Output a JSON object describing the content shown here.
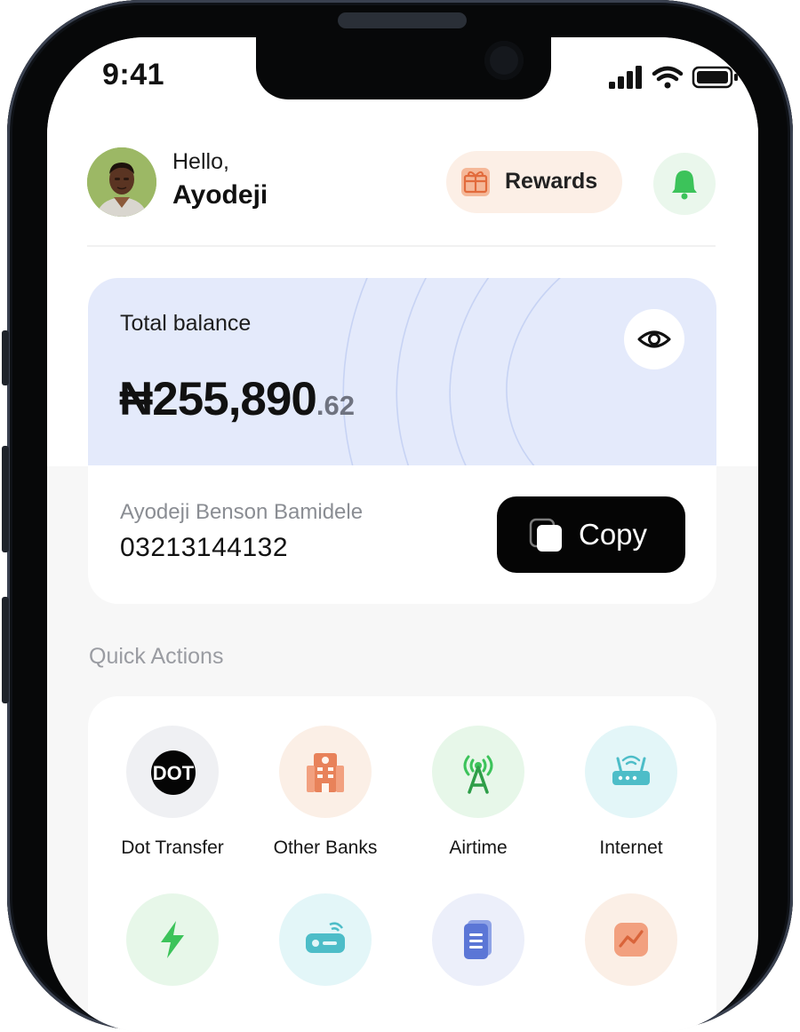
{
  "status_bar": {
    "time": "9:41"
  },
  "header": {
    "greeting": "Hello,",
    "user_name": "Ayodeji",
    "rewards_label": "Rewards"
  },
  "balance_card": {
    "label": "Total balance",
    "amount_main": "₦255,890",
    "amount_decimal": ".62",
    "account_name": "Ayodeji Benson Bamidele",
    "account_number": "03213144132",
    "copy_label": "Copy"
  },
  "quick_actions": {
    "title": "Quick Actions",
    "items": [
      {
        "label": "Dot Transfer",
        "icon": "dot-logo-icon",
        "bg": "#eff0f3",
        "logo_text": "DOT"
      },
      {
        "label": "Other Banks",
        "icon": "bank-building-icon",
        "bg": "#fbefe6"
      },
      {
        "label": "Airtime",
        "icon": "signal-tower-icon",
        "bg": "#e7f7e9"
      },
      {
        "label": "Internet",
        "icon": "router-icon",
        "bg": "#e3f6f8"
      },
      {
        "label": "",
        "icon": "lightning-icon",
        "bg": "#e7f7e9"
      },
      {
        "label": "",
        "icon": "cable-tv-decoder-icon",
        "bg": "#e3f6f8"
      },
      {
        "label": "",
        "icon": "document-icon",
        "bg": "#eceffa"
      },
      {
        "label": "",
        "icon": "chart-icon",
        "bg": "#fbefe6"
      }
    ]
  },
  "colors": {
    "card_top": "#e4eafb",
    "copy_button": "#050505",
    "rewards_bg": "#fcefe6",
    "bell_green": "#3cc35a",
    "accent_orange": "#e8825a"
  }
}
